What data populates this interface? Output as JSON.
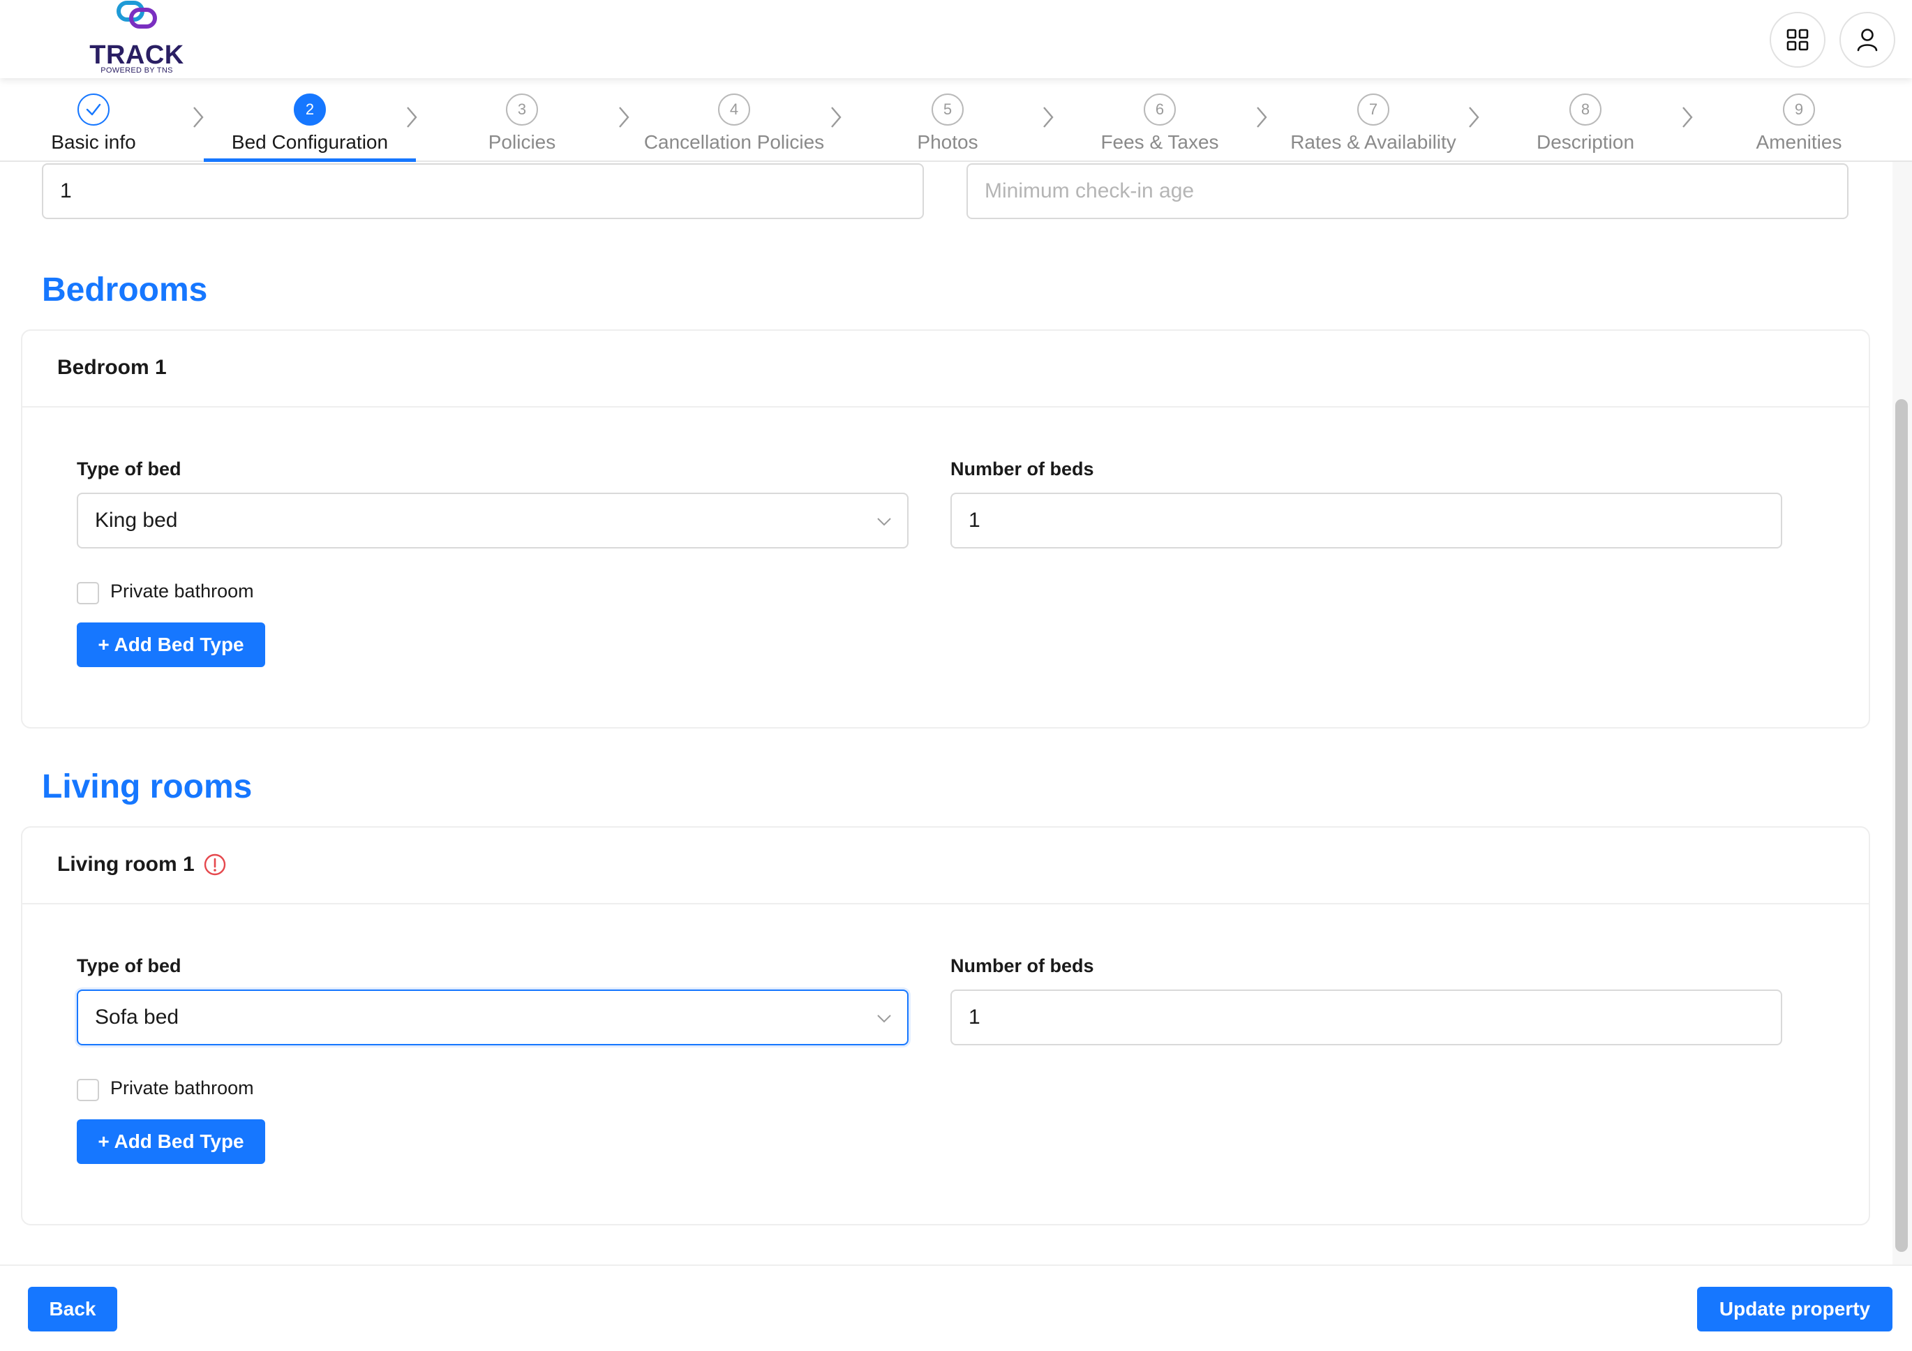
{
  "header": {
    "logo_text": "TRACK",
    "logo_subtext": "POWERED BY TNS",
    "apps_icon": "grid-icon",
    "user_icon": "user-icon"
  },
  "steps": [
    {
      "number": "1",
      "label": "Basic info",
      "state": "done"
    },
    {
      "number": "2",
      "label": "Bed Configuration",
      "state": "active"
    },
    {
      "number": "3",
      "label": "Policies",
      "state": "pending"
    },
    {
      "number": "4",
      "label": "Cancellation Policies",
      "state": "pending"
    },
    {
      "number": "5",
      "label": "Photos",
      "state": "pending"
    },
    {
      "number": "6",
      "label": "Fees & Taxes",
      "state": "pending"
    },
    {
      "number": "7",
      "label": "Rates & Availability",
      "state": "pending"
    },
    {
      "number": "8",
      "label": "Description",
      "state": "pending"
    },
    {
      "number": "9",
      "label": "Amenities",
      "state": "pending"
    }
  ],
  "top_fields": {
    "left_value": "1",
    "right_placeholder": "Minimum check-in age"
  },
  "bedrooms": {
    "section_title": "Bedrooms",
    "card_title": "Bedroom 1",
    "type_label": "Type of bed",
    "type_value": "King bed",
    "count_label": "Number of beds",
    "count_value": "1",
    "checkbox_label": "Private bathroom",
    "add_button": "+ Add Bed Type"
  },
  "living_rooms": {
    "section_title": "Living rooms",
    "card_title": "Living room 1",
    "warning_icon": "exclamation-circle-icon",
    "type_label": "Type of bed",
    "type_value": "Sofa bed",
    "count_label": "Number of beds",
    "count_value": "1",
    "checkbox_label": "Private bathroom",
    "add_button": "+ Add Bed Type"
  },
  "footer": {
    "back_button": "Back",
    "update_button": "Update property"
  },
  "colors": {
    "accent": "#1677ff",
    "brand": "#2a1f63",
    "warning": "#e5484d"
  }
}
